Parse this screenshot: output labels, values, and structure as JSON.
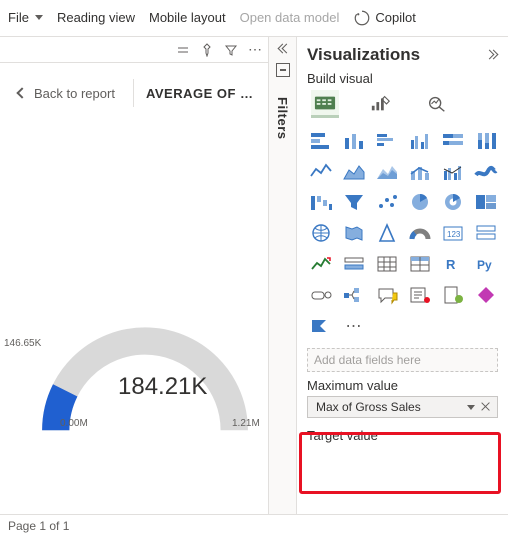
{
  "topbar": {
    "file": "File",
    "reading_view": "Reading view",
    "mobile_layout": "Mobile layout",
    "open_data_model": "Open data model",
    "copilot": "Copilot"
  },
  "canvas": {
    "back": "Back to report",
    "title": "AVERAGE OF …",
    "gauge": {
      "min_label": "146.65K",
      "value": "184.21K",
      "zero": "0.00M",
      "max": "1.21M"
    }
  },
  "filters_panel": {
    "label": "Filters"
  },
  "vis": {
    "title": "Visualizations",
    "build": "Build visual",
    "add_placeholder": "Add data fields here",
    "max_section": "Maximum value",
    "max_pill": "Max of Gross Sales",
    "target_section": "Target value"
  },
  "footer": {
    "page": "Page 1 of 1"
  },
  "chart_data": {
    "type": "gauge",
    "value": 184210,
    "min": 0,
    "max": 1210000,
    "segments": [
      {
        "name": "filled",
        "start": 0,
        "end": 184210,
        "color": "#2060d0"
      },
      {
        "name": "remaining",
        "start": 184210,
        "end": 1210000,
        "color": "#d9d9d9"
      }
    ],
    "marker_label": "146.65K",
    "value_label": "184.21K",
    "min_label": "0.00M",
    "max_label": "1.21M"
  }
}
